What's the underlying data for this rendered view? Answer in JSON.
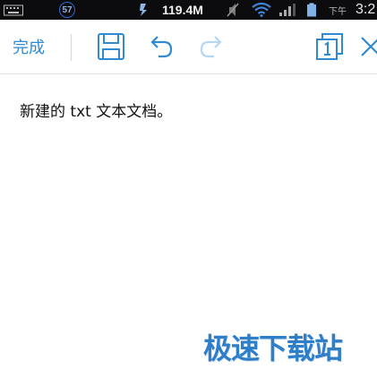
{
  "status_bar": {
    "notification_count": "57",
    "data_speed": "119.4M",
    "speed_badge": "M",
    "am_pm": "下午",
    "time": "3:2",
    "icons": [
      "keyboard-icon",
      "notification-badge-icon",
      "speed-indicator-icon",
      "mute-icon",
      "wifi-icon",
      "signal-icon",
      "battery-icon"
    ]
  },
  "toolbar": {
    "done_label": "完成",
    "icons": [
      "save-icon",
      "undo-icon",
      "redo-icon",
      "window-icon",
      "close-icon"
    ],
    "accent_color": "#2f8ad0",
    "disabled_color": "#b7d6ef"
  },
  "document": {
    "text": "新建的 txt 文本文档。"
  },
  "watermark": {
    "text": "极速下载站"
  }
}
